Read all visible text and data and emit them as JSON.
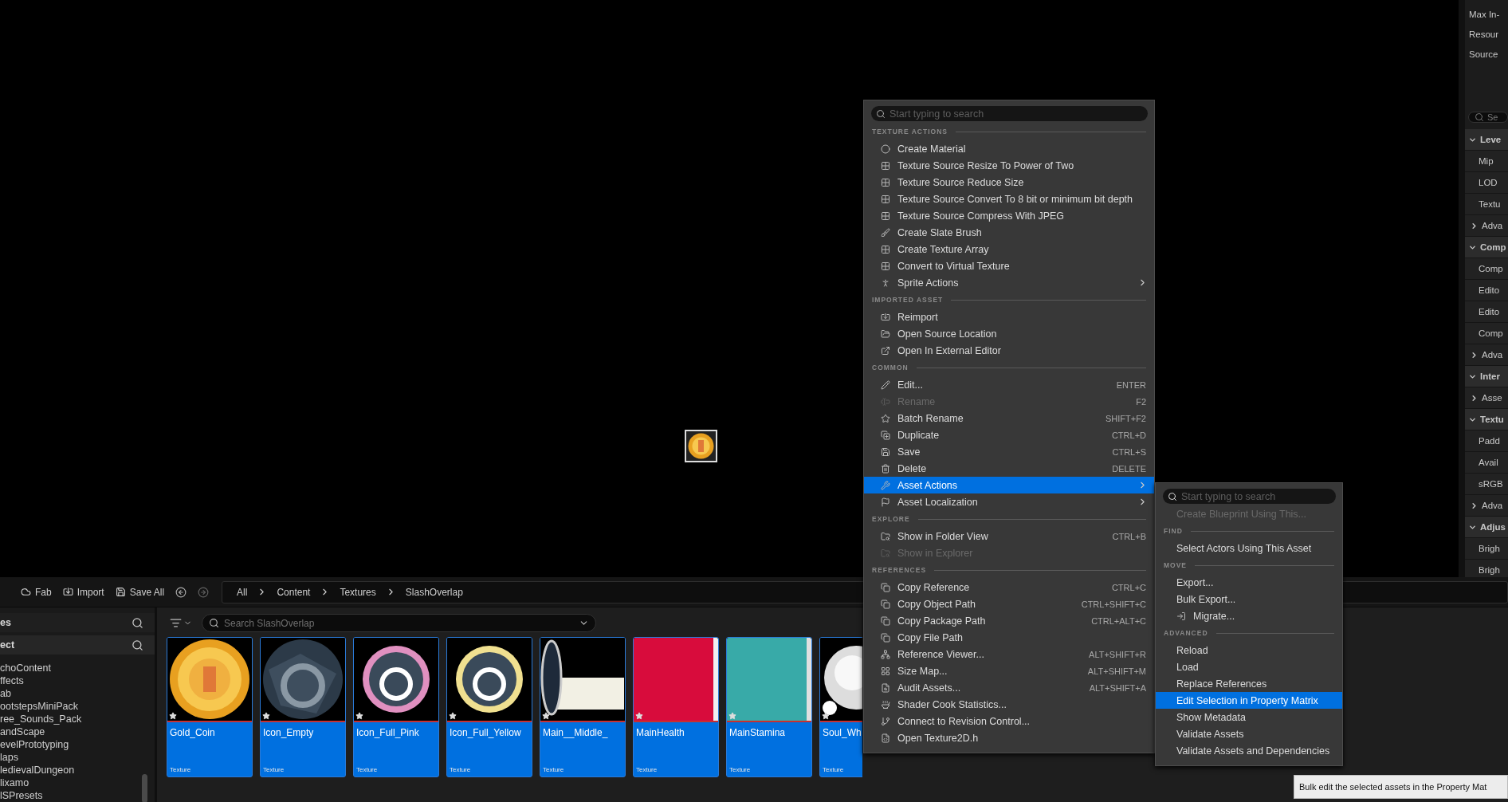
{
  "details_panel": {
    "rows": [
      {
        "kind": "field",
        "text": "Max In-"
      },
      {
        "kind": "field",
        "text": "Resour"
      },
      {
        "kind": "field",
        "text": "Source"
      },
      {
        "kind": "search",
        "text": "Se"
      },
      {
        "kind": "section",
        "text": "Leve",
        "expanded": true
      },
      {
        "kind": "row",
        "text": "Mip"
      },
      {
        "kind": "row",
        "text": "LOD"
      },
      {
        "kind": "row",
        "text": "Textu"
      },
      {
        "kind": "group",
        "text": "Adva",
        "expanded": false
      },
      {
        "kind": "section",
        "text": "Comp",
        "expanded": true
      },
      {
        "kind": "row",
        "text": "Comp"
      },
      {
        "kind": "row",
        "text": "Edito"
      },
      {
        "kind": "row",
        "text": "Edito"
      },
      {
        "kind": "row",
        "text": "Comp"
      },
      {
        "kind": "group",
        "text": "Adva",
        "expanded": false
      },
      {
        "kind": "section",
        "text": "Inter",
        "expanded": true
      },
      {
        "kind": "group",
        "text": "Asse",
        "expanded": false
      },
      {
        "kind": "section",
        "text": "Textu",
        "expanded": true
      },
      {
        "kind": "row",
        "text": "Padd"
      },
      {
        "kind": "row",
        "text": "Avail"
      },
      {
        "kind": "row",
        "text": "sRGB"
      },
      {
        "kind": "group",
        "text": "Adva",
        "expanded": false
      },
      {
        "kind": "section",
        "text": "Adjus",
        "expanded": true
      },
      {
        "kind": "row",
        "text": "Brigh"
      },
      {
        "kind": "row",
        "text": "Brigh"
      }
    ]
  },
  "toolbar": {
    "buttons": [
      "Fab",
      "Import",
      "Save All"
    ],
    "breadcrumb": [
      "All",
      "Content",
      "Textures",
      "SlashOverlap"
    ]
  },
  "sidebar": {
    "headers": [
      "es",
      "ect"
    ],
    "items": [
      "choContent",
      "ffects",
      "ab",
      "ootstepsMiniPack",
      "ree_Sounds_Pack",
      "andScape",
      "evelPrototyping",
      "laps",
      "ledievalDungeon",
      "lixamo",
      "lSPresets"
    ]
  },
  "asset_grid": {
    "search_placeholder": "Search SlashOverlap",
    "assets": [
      {
        "name": "Gold_Coin",
        "type": "Texture",
        "selected": true
      },
      {
        "name": "Icon_Empty",
        "type": "Texture",
        "selected": true
      },
      {
        "name": "Icon_Full_Pink",
        "type": "Texture",
        "selected": true
      },
      {
        "name": "Icon_Full_Yellow",
        "type": "Texture",
        "selected": true
      },
      {
        "name": "Main__Middle_",
        "type": "Texture",
        "selected": true
      },
      {
        "name": "MainHealth",
        "type": "Texture",
        "selected": true
      },
      {
        "name": "MainStamina",
        "type": "Texture",
        "selected": true
      },
      {
        "name": "Soul_Wh",
        "type": "Texture",
        "selected": true
      }
    ]
  },
  "context_menu": {
    "search_placeholder": "Start typing to search",
    "sections": [
      {
        "heading": "TEXTURE ACTIONS",
        "items": [
          {
            "label": "Create Material",
            "selected": false,
            "disabled": false,
            "submenu": false
          },
          {
            "label": "Texture Source Resize To Power of Two",
            "selected": false,
            "disabled": false,
            "submenu": false
          },
          {
            "label": "Texture Source Reduce Size",
            "selected": false,
            "disabled": false,
            "submenu": false
          },
          {
            "label": "Texture Source Convert To 8 bit or minimum bit depth",
            "selected": false,
            "disabled": false,
            "submenu": false
          },
          {
            "label": "Texture Source Compress With JPEG",
            "selected": false,
            "disabled": false,
            "submenu": false
          },
          {
            "label": "Create Slate Brush",
            "selected": false,
            "disabled": false,
            "submenu": false
          },
          {
            "label": "Create Texture Array",
            "selected": false,
            "disabled": false,
            "submenu": false
          },
          {
            "label": "Convert to Virtual Texture",
            "selected": false,
            "disabled": false,
            "submenu": false
          },
          {
            "label": "Sprite Actions",
            "selected": false,
            "disabled": false,
            "submenu": true
          }
        ]
      },
      {
        "heading": "IMPORTED ASSET",
        "items": [
          {
            "label": "Reimport",
            "selected": false,
            "disabled": false,
            "submenu": false
          },
          {
            "label": "Open Source Location",
            "selected": false,
            "disabled": false,
            "submenu": false
          },
          {
            "label": "Open In External Editor",
            "selected": false,
            "disabled": false,
            "submenu": false
          }
        ]
      },
      {
        "heading": "COMMON",
        "items": [
          {
            "label": "Edit...",
            "shortcut": "ENTER",
            "selected": false,
            "disabled": false,
            "submenu": false
          },
          {
            "label": "Rename",
            "shortcut": "F2",
            "selected": false,
            "disabled": true,
            "submenu": false
          },
          {
            "label": "Batch Rename",
            "shortcut": "SHIFT+F2",
            "selected": false,
            "disabled": false,
            "submenu": false
          },
          {
            "label": "Duplicate",
            "shortcut": "CTRL+D",
            "selected": false,
            "disabled": false,
            "submenu": false
          },
          {
            "label": "Save",
            "shortcut": "CTRL+S",
            "selected": false,
            "disabled": false,
            "submenu": false
          },
          {
            "label": "Delete",
            "shortcut": "DELETE",
            "selected": false,
            "disabled": false,
            "submenu": false
          },
          {
            "label": "Asset Actions",
            "selected": true,
            "disabled": false,
            "submenu": true
          },
          {
            "label": "Asset Localization",
            "selected": false,
            "disabled": false,
            "submenu": true
          }
        ]
      },
      {
        "heading": "EXPLORE",
        "items": [
          {
            "label": "Show in Folder View",
            "shortcut": "CTRL+B",
            "selected": false,
            "disabled": false,
            "submenu": false
          },
          {
            "label": "Show in Explorer",
            "selected": false,
            "disabled": true,
            "submenu": false
          }
        ]
      },
      {
        "heading": "REFERENCES",
        "items": [
          {
            "label": "Copy Reference",
            "shortcut": "CTRL+C",
            "selected": false,
            "disabled": false,
            "submenu": false
          },
          {
            "label": "Copy Object Path",
            "shortcut": "CTRL+SHIFT+C",
            "selected": false,
            "disabled": false,
            "submenu": false
          },
          {
            "label": "Copy Package Path",
            "shortcut": "CTRL+ALT+C",
            "selected": false,
            "disabled": false,
            "submenu": false
          },
          {
            "label": "Copy File Path",
            "selected": false,
            "disabled": false,
            "submenu": false
          },
          {
            "label": "Reference Viewer...",
            "shortcut": "ALT+SHIFT+R",
            "selected": false,
            "disabled": false,
            "submenu": false
          },
          {
            "label": "Size Map...",
            "shortcut": "ALT+SHIFT+M",
            "selected": false,
            "disabled": false,
            "submenu": false
          },
          {
            "label": "Audit Assets...",
            "shortcut": "ALT+SHIFT+A",
            "selected": false,
            "disabled": false,
            "submenu": false
          },
          {
            "label": "Shader Cook Statistics...",
            "selected": false,
            "disabled": false,
            "submenu": false
          },
          {
            "label": "Connect to Revision Control...",
            "selected": false,
            "disabled": false,
            "submenu": false
          },
          {
            "label": "Open Texture2D.h",
            "selected": false,
            "disabled": false,
            "submenu": false
          }
        ]
      }
    ]
  },
  "submenu": {
    "search_placeholder": "Start typing to search",
    "sections": [
      {
        "items": [
          {
            "label": "Create Blueprint Using This...",
            "selected": false,
            "disabled": true
          }
        ]
      },
      {
        "heading": "FIND",
        "items": [
          {
            "label": "Select Actors Using This Asset",
            "selected": false,
            "disabled": false
          }
        ]
      },
      {
        "heading": "MOVE",
        "items": [
          {
            "label": "Export...",
            "selected": false,
            "disabled": false
          },
          {
            "label": "Bulk Export...",
            "selected": false,
            "disabled": false
          },
          {
            "label": "Migrate...",
            "selected": false,
            "disabled": false
          }
        ]
      },
      {
        "heading": "ADVANCED",
        "items": [
          {
            "label": "Reload",
            "selected": false,
            "disabled": false
          },
          {
            "label": "Load",
            "selected": false,
            "disabled": false
          },
          {
            "label": "Replace References",
            "selected": false,
            "disabled": false
          },
          {
            "label": "Edit Selection in Property Matrix",
            "selected": true,
            "disabled": false
          },
          {
            "label": "Show Metadata",
            "selected": false,
            "disabled": false
          },
          {
            "label": "Validate Assets",
            "selected": false,
            "disabled": false
          },
          {
            "label": "Validate Assets and Dependencies",
            "selected": false,
            "disabled": false
          }
        ]
      }
    ]
  },
  "tooltip": {
    "text": "Bulk edit the selected assets in the Property Mat"
  }
}
